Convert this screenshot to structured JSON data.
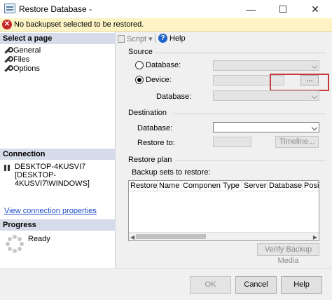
{
  "window": {
    "title": "Restore Database -",
    "minimize_glyph": "—",
    "maximize_glyph": "☐",
    "close_glyph": "✕"
  },
  "error": {
    "icon": "error-x-icon",
    "icon_glyph": "✕",
    "text": "No backupset selected to be restored."
  },
  "sidebar": {
    "select_page_header": "Select a page",
    "pages": [
      {
        "label": "General"
      },
      {
        "label": "Files"
      },
      {
        "label": "Options"
      }
    ],
    "connection_header": "Connection",
    "connection_server": "DESKTOP-4KUSVI7",
    "connection_user": "[DESKTOP-4KUSVI7\\WINDOWS]",
    "connection_link": "View connection properties",
    "progress_header": "Progress",
    "progress_status": "Ready"
  },
  "toolbar": {
    "script_label": "Script",
    "script_arrow": "▾",
    "help_label": "Help",
    "help_glyph": "?"
  },
  "source": {
    "group_label": "Source",
    "database_radio_label": "Database:",
    "device_radio_label": "Device:",
    "device_button_label": "...",
    "database_label": "Database:",
    "selected_option": "device"
  },
  "destination": {
    "group_label": "Destination",
    "database_label": "Database:",
    "restore_to_label": "Restore to:",
    "timeline_button": "Timeline..."
  },
  "restore_plan": {
    "group_label": "Restore plan",
    "backup_sets_label": "Backup sets to restore:",
    "columns": [
      "Restore",
      "Name",
      "Component",
      "Type",
      "Server",
      "Database",
      "Position"
    ],
    "scroll_left_glyph": "◀",
    "scroll_right_glyph": "▶",
    "verify_button": "Verify Backup Media"
  },
  "footer": {
    "ok_label": "OK",
    "cancel_label": "Cancel",
    "help_label": "Help"
  },
  "colors": {
    "error_bg": "#fdf3c4",
    "section_header_bg": "#d6dbe9",
    "link": "#1f4ec7",
    "highlight_box": "#c43a3a"
  }
}
